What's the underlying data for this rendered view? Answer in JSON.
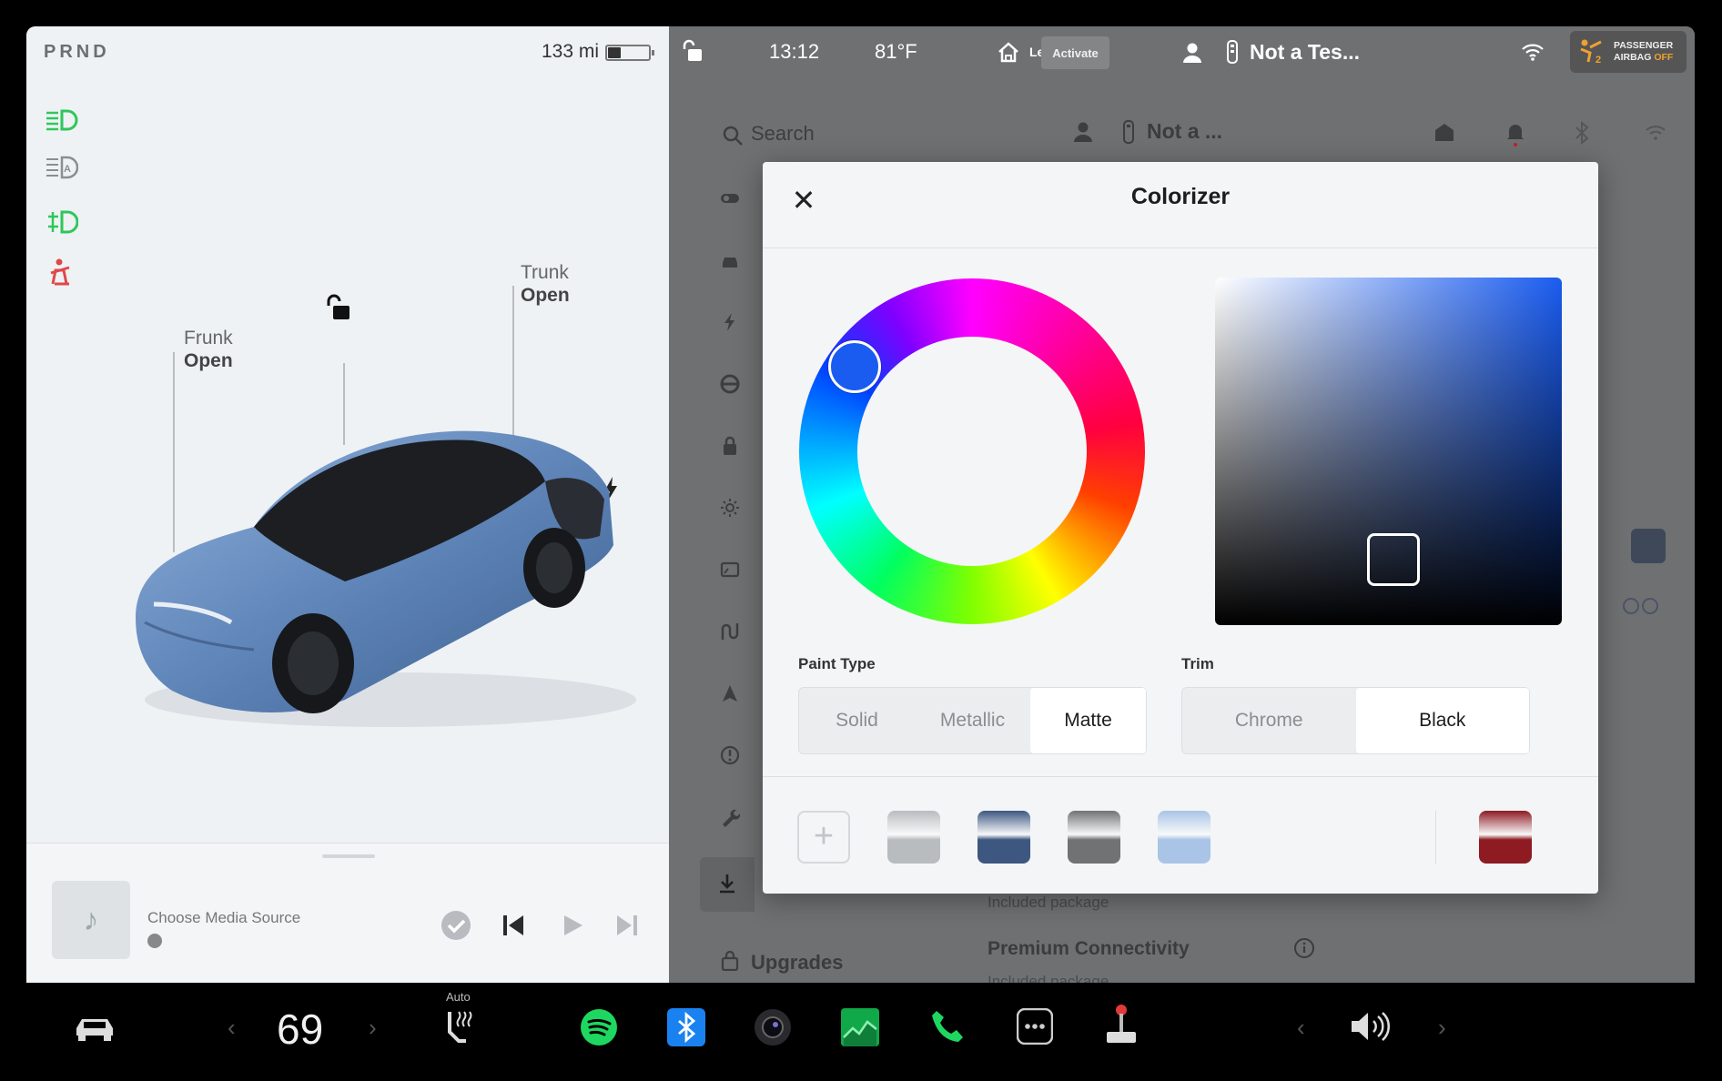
{
  "left_panel": {
    "gear": [
      "P",
      "R",
      "N",
      "D"
    ],
    "range": "133 mi",
    "battery_level": 0.3,
    "icons": [
      "headlights-icon",
      "auto-highbeam-icon",
      "fog-lights-icon",
      "seatbelt-warning-icon"
    ],
    "frunk": {
      "label": "Frunk",
      "state": "Open"
    },
    "trunk": {
      "label": "Trunk",
      "state": "Open"
    },
    "media": {
      "title": "Choose Media Source"
    }
  },
  "topbar": {
    "time": "13:12",
    "temp": "81°F",
    "homelink": "Left",
    "activate": "Activate",
    "profile": "Not a Tes...",
    "airbag_line1": "PASSENGER",
    "airbag_line2": "AIRBAG",
    "airbag_off": "OFF"
  },
  "settings": {
    "search": "Search",
    "profile": "Not a ...",
    "included_1": "Included package",
    "premium": "Premium Connectivity",
    "included_2": "Included package",
    "upgrades": "Upgrades"
  },
  "modal": {
    "title": "Colorizer",
    "paint_label": "Paint Type",
    "paint_options": [
      "Solid",
      "Metallic",
      "Matte"
    ],
    "paint_selected": "Matte",
    "trim_label": "Trim",
    "trim_options": [
      "Chrome",
      "Black"
    ],
    "trim_selected": "Black",
    "swatches": [
      "#b9bcbf",
      "#3d5781",
      "#707274",
      "#a9c4e6",
      "#8e1a22"
    ],
    "selected_color": "#1a5cf0"
  },
  "dock": {
    "temperature": "69",
    "seat_heat_label": "Auto"
  }
}
